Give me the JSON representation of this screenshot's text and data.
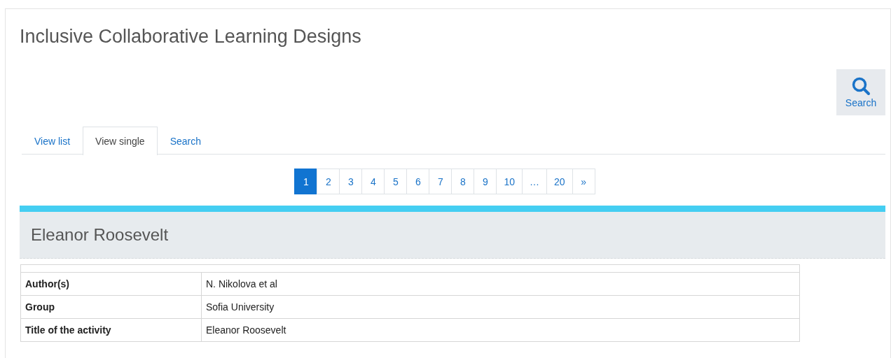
{
  "page": {
    "title": "Inclusive Collaborative Learning Designs"
  },
  "search_button": {
    "label": "Search"
  },
  "tabs": [
    {
      "label": "View list",
      "selected": false
    },
    {
      "label": "View single",
      "selected": true
    },
    {
      "label": "Search",
      "selected": false
    }
  ],
  "pagination": [
    {
      "label": "1",
      "selected": true
    },
    {
      "label": "2",
      "selected": false
    },
    {
      "label": "3",
      "selected": false
    },
    {
      "label": "4",
      "selected": false
    },
    {
      "label": "5",
      "selected": false
    },
    {
      "label": "6",
      "selected": false
    },
    {
      "label": "7",
      "selected": false
    },
    {
      "label": "8",
      "selected": false
    },
    {
      "label": "9",
      "selected": false
    },
    {
      "label": "10",
      "selected": false
    },
    {
      "label": "…",
      "selected": false
    },
    {
      "label": "20",
      "selected": false
    },
    {
      "label": "»",
      "selected": false
    }
  ],
  "record": {
    "title": "Eleanor Roosevelt",
    "fields": [
      {
        "label": "Author(s)",
        "value": "N. Nikolova et al"
      },
      {
        "label": "Group",
        "value": "Sofia University"
      },
      {
        "label": "Title of the activity",
        "value": "Eleanor Roosevelt"
      }
    ]
  }
}
